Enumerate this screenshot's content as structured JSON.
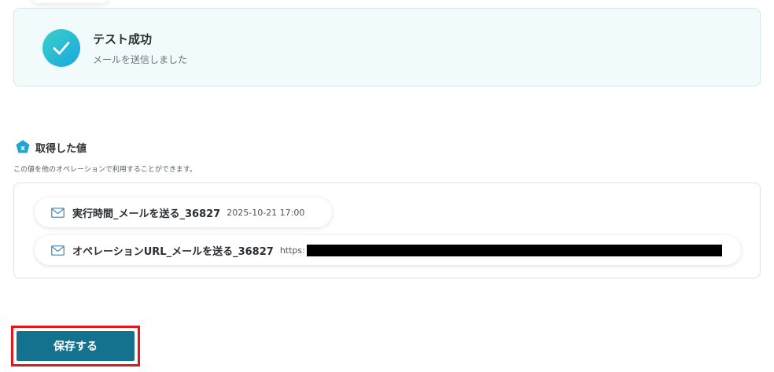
{
  "success": {
    "title": "テスト成功",
    "subtitle": "メールを送信しました"
  },
  "retrieved": {
    "title": "取得した値",
    "description": "この値を他のオペレーションで利用することができます。",
    "items": [
      {
        "label": "実行時間_メールを送る_36827",
        "value": "2025-10-21 17:00"
      },
      {
        "label": "オペレーションURL_メールを送る_36827",
        "value": "https:"
      }
    ]
  },
  "footer": {
    "save_label": "保存する"
  },
  "colors": {
    "accent": "#13738f",
    "success_gradient_start": "#3ad0c8",
    "success_gradient_end": "#1aa7e0",
    "highlight_border": "#e01818",
    "card_background": "#f2fbfb"
  },
  "icons": {
    "success": "check-circle-icon",
    "section": "variable-icon",
    "item": "mail-icon"
  }
}
